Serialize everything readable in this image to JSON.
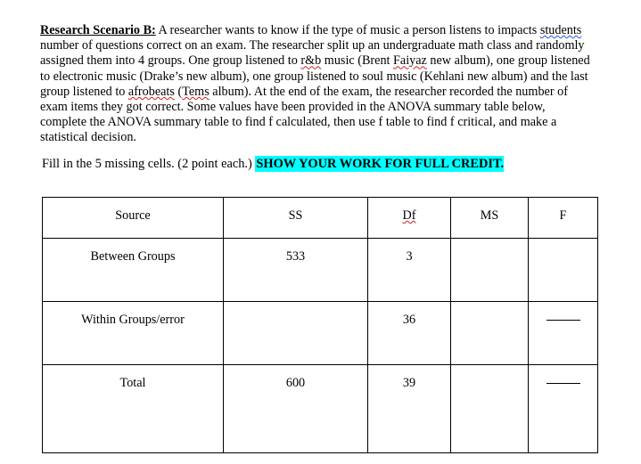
{
  "document": {
    "scenario": {
      "lead_label": "Research Scenario B:",
      "body_part_1": " A researcher wants to know if the type of music a person listens to impacts ",
      "misspelled_students": "students",
      "body_part_2": " number of questions correct on an exam. The researcher split up an undergraduate math class and randomly assigned them into 4 groups. One group listened to ",
      "misspelled_rb": "r&b",
      "body_part_3": " music (Brent ",
      "misspelled_faiyaz": "Faiyaz",
      "body_part_4": " new album), one group listened to electronic music (Drake’s new album), one group listened to soul music (Kehlani new album) and the last group listened to ",
      "misspelled_afrobeats": "afrobeats",
      "body_part_5": " (",
      "misspelled_tems": "Tems",
      "body_part_6": " album). At the end of the exam, the researcher recorded the number of exam items they got correct. Some values have been provided in the ANOVA summary table below, complete the ANOVA summary table to find f calculated, then use f table to find f critical, and make a statistical decision."
    },
    "instruction": {
      "plain_text": "Fill in the 5 missing cells. (2 point each.) ",
      "highlighted_text": "SHOW YOUR WORK FOR FULL CREDIT.",
      "highlight_color": "#00FFFF"
    },
    "anova_table": {
      "columns": [
        "Source",
        "SS",
        "Df",
        "MS",
        "F"
      ],
      "rows": [
        {
          "source": "Between Groups",
          "ss": "533",
          "df": "3",
          "ms": "",
          "f": ""
        },
        {
          "source": "Within Groups/error",
          "ss": "",
          "df": "36",
          "ms": "",
          "f": "—"
        },
        {
          "source": "Total",
          "ss": "600",
          "df": "39",
          "ms": "",
          "f": "—"
        }
      ]
    }
  }
}
